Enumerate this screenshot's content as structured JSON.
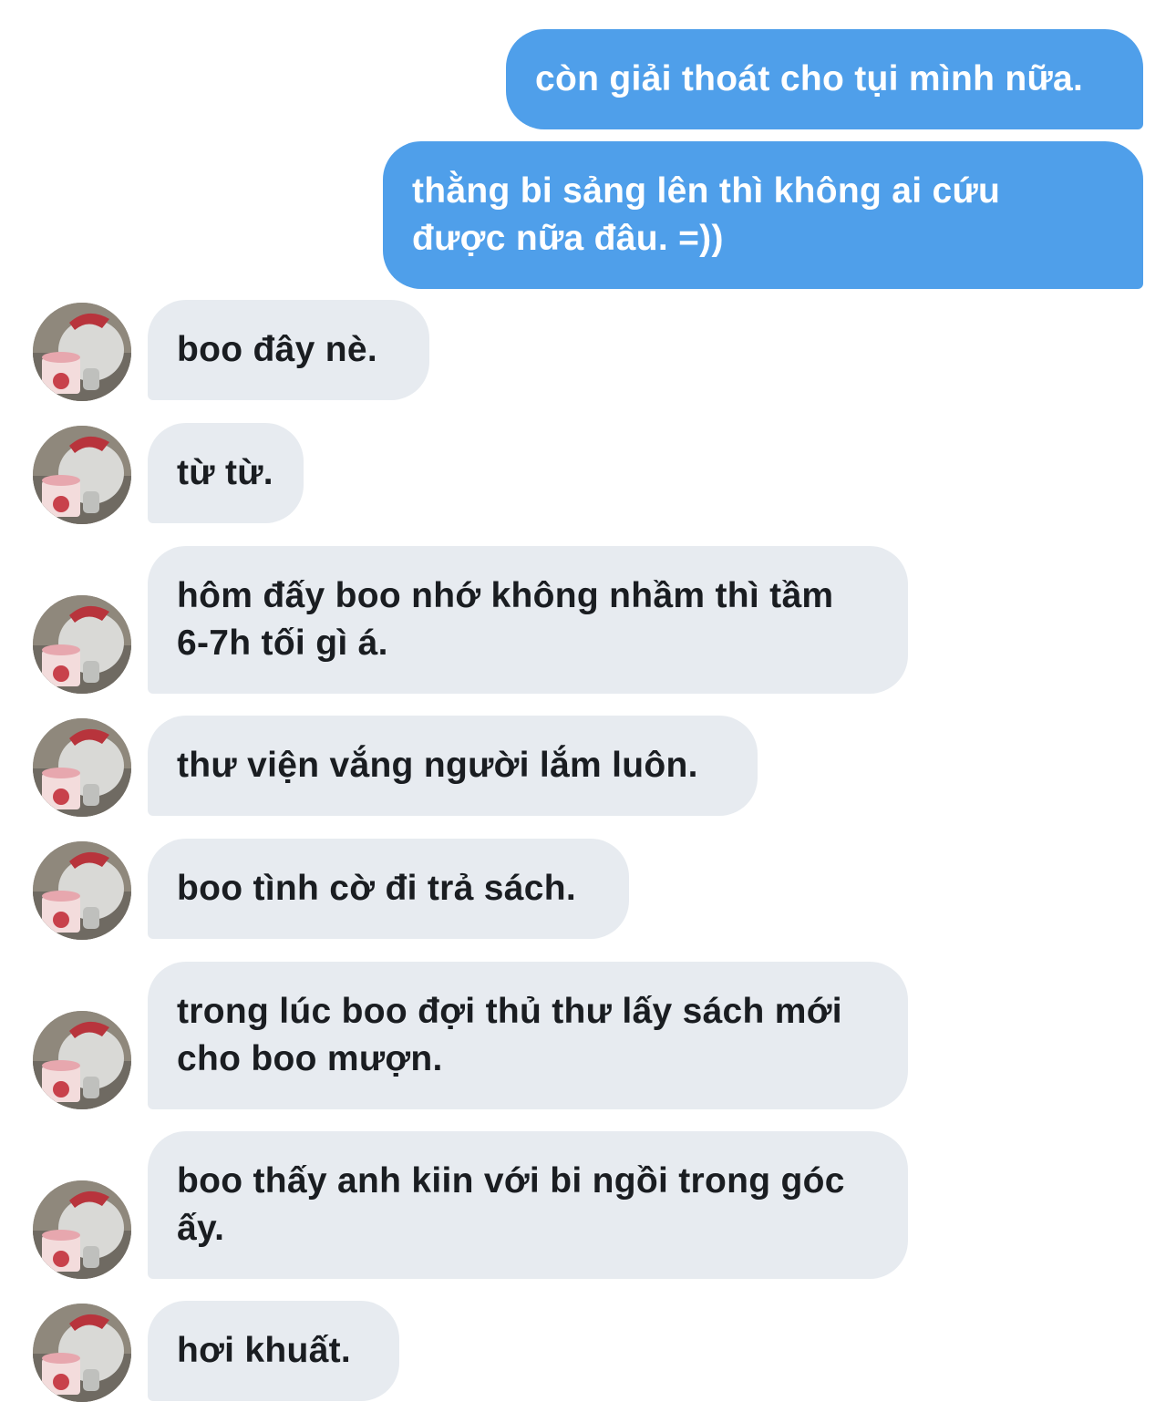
{
  "conversation": {
    "messages": [
      {
        "side": "out",
        "text": "còn giải thoát cho tụi mình nữa."
      },
      {
        "side": "out",
        "text": "thằng bi sảng lên thì không ai cứu\nđược nữa đâu. =))"
      },
      {
        "side": "in",
        "text": "boo đây nè."
      },
      {
        "side": "in",
        "text": "từ từ."
      },
      {
        "side": "in",
        "text": "hôm đấy boo nhớ không nhầm thì tầm\n6-7h tối gì á."
      },
      {
        "side": "in",
        "text": "thư viện vắng người lắm luôn."
      },
      {
        "side": "in",
        "text": "boo tình cờ đi trả sách."
      },
      {
        "side": "in",
        "text": "trong lúc boo đợi thủ thư lấy sách mới\ncho boo mượn."
      },
      {
        "side": "in",
        "text": "boo thấy anh kiin với bi ngồi trong góc\nấy."
      },
      {
        "side": "in",
        "text": "hơi khuất."
      }
    ]
  },
  "colors": {
    "outgoing_bubble": "#4f9fea",
    "incoming_bubble": "#e7ebf0",
    "incoming_text": "#1a1d21"
  },
  "avatar": {
    "icon": "bear-with-ice-cream-avatar-icon"
  }
}
